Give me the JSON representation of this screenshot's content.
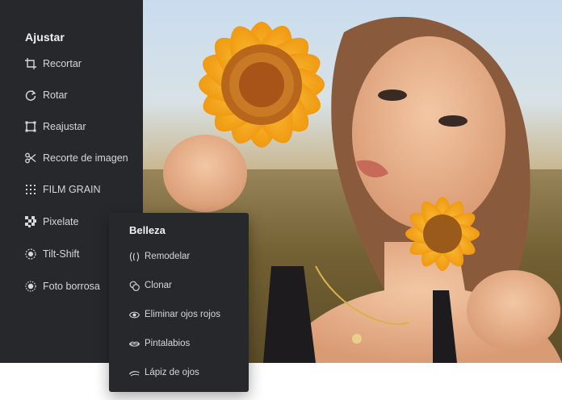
{
  "sidebar": {
    "title": "Ajustar",
    "items": [
      {
        "label": "Recortar",
        "icon": "crop-icon"
      },
      {
        "label": "Rotar",
        "icon": "rotate-icon"
      },
      {
        "label": "Reajustar",
        "icon": "resize-icon"
      },
      {
        "label": "Recorte de imagen",
        "icon": "scissors-icon"
      },
      {
        "label": "FILM GRAIN",
        "icon": "grain-icon"
      },
      {
        "label": "Pixelate",
        "icon": "pixelate-icon"
      },
      {
        "label": "Tilt-Shift",
        "icon": "tilt-shift-icon"
      },
      {
        "label": "Foto borrosa",
        "icon": "blur-icon"
      }
    ]
  },
  "beauty_panel": {
    "title": "Belleza",
    "items": [
      {
        "label": "Remodelar",
        "icon": "reshape-icon"
      },
      {
        "label": "Clonar",
        "icon": "clone-icon"
      },
      {
        "label": "Eliminar ojos rojos",
        "icon": "eye-icon"
      },
      {
        "label": "Pintalabios",
        "icon": "lips-icon"
      },
      {
        "label": "Lápiz de ojos",
        "icon": "eyeliner-icon"
      }
    ]
  },
  "colors": {
    "panel_bg": "#27282c",
    "panel_text": "#d6d7db",
    "title_text": "#f1f1f3",
    "sunflower": "#f4a51c"
  }
}
